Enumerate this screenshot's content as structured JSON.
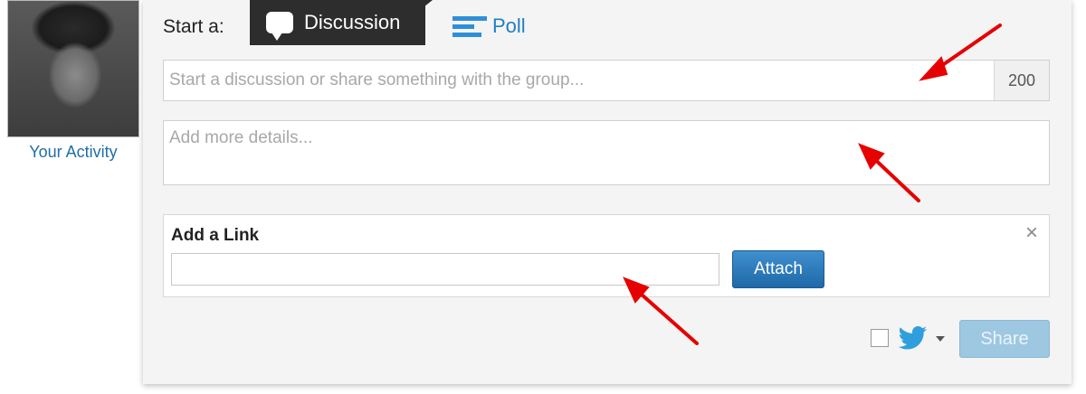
{
  "sidebar": {
    "activity_link": "Your Activity"
  },
  "composer": {
    "start_label": "Start a:",
    "tabs": [
      {
        "label": "Discussion",
        "active": true,
        "icon": "speech-bubble-icon"
      },
      {
        "label": "Poll",
        "active": false,
        "icon": "poll-bars-icon"
      }
    ],
    "title_placeholder": "Start a discussion or share something with the group...",
    "title_value": "",
    "char_count": "200",
    "details_placeholder": "Add more details...",
    "details_value": ""
  },
  "link_section": {
    "title": "Add a Link",
    "close_glyph": "×",
    "url_value": "",
    "attach_label": "Attach"
  },
  "share_row": {
    "twitter_checked": false,
    "share_label": "Share",
    "share_enabled": false
  },
  "colors": {
    "accent": "#1f7fc4",
    "active_tab_bg": "#2d2d2d",
    "attach_btn": "#2a78b8",
    "share_btn_disabled": "#9ec7e2",
    "annotation_arrow": "#e60000"
  }
}
